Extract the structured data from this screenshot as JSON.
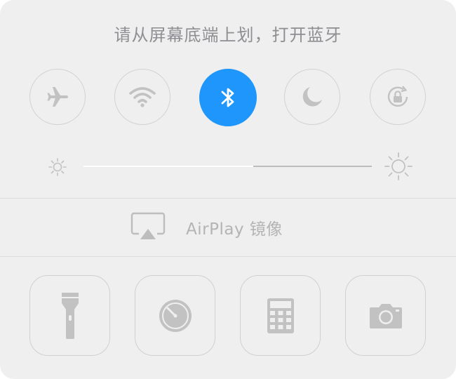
{
  "instruction": "请从屏幕底端上划，打开蓝牙",
  "toggles": [
    {
      "icon": "airplane-icon",
      "active": false
    },
    {
      "icon": "wifi-icon",
      "active": false
    },
    {
      "icon": "bluetooth-icon",
      "active": true
    },
    {
      "icon": "moon-icon",
      "active": false
    },
    {
      "icon": "rotation-lock-icon",
      "active": false
    }
  ],
  "brightness": {
    "level": 0.59
  },
  "airplay": {
    "label": "AirPlay 镜像"
  },
  "shortcuts": [
    {
      "icon": "flashlight-icon"
    },
    {
      "icon": "timer-icon"
    },
    {
      "icon": "calculator-icon"
    },
    {
      "icon": "camera-icon"
    }
  ],
  "colors": {
    "panel_bg": "#efefef",
    "active_toggle": "#1e96fb",
    "icon_gray": "#c2c2c2",
    "text_gray": "#8e8e93"
  }
}
